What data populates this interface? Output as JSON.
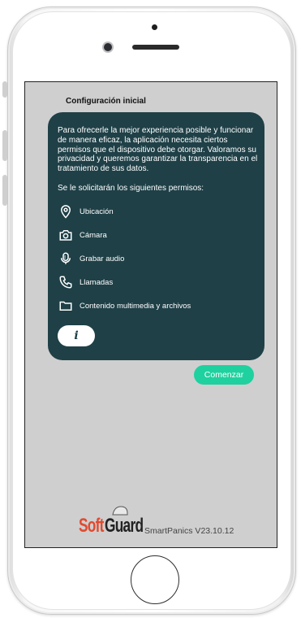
{
  "screen": {
    "title": "Configuración inicial",
    "intro": "Para ofrecerle la mejor experiencia posible y funcionar de manera eficaz, la aplicación necesita ciertos permisos que el dispositivo debe otorgar. Valoramos su privacidad y queremos garantizar la transparencia en el tratamiento de sus datos.",
    "permissions_heading": "Se le solicitarán los siguientes permisos:",
    "permissions": [
      {
        "label": "Ubicación",
        "icon": "location-pin-icon"
      },
      {
        "label": "Cámara",
        "icon": "camera-icon"
      },
      {
        "label": "Grabar audio",
        "icon": "microphone-icon"
      },
      {
        "label": "Llamadas",
        "icon": "phone-icon"
      },
      {
        "label": "Contenido multimedia y archivos",
        "icon": "folder-icon"
      }
    ],
    "info_button_label": "i",
    "start_button_label": "Comenzar"
  },
  "footer": {
    "logo_soft": "Soft",
    "logo_guard": "Guard",
    "version": "SmartPanics V23.10.12"
  },
  "colors": {
    "card_bg": "#1f4047",
    "accent": "#1fd19f",
    "screen_bg": "#cfcfcf",
    "logo_red": "#e24a2f"
  }
}
